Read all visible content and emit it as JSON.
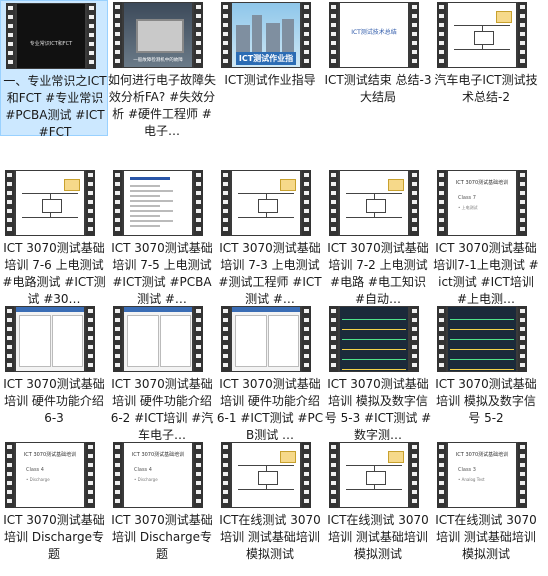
{
  "tiles": [
    {
      "caption": "一、专业常识之ICT和FCT #专业常识 #PCBA测试 #ICT #FCT",
      "thumb": "dark",
      "dark_title": "专业常识ICT和FCT",
      "selected": true
    },
    {
      "caption": "如何进行电子故障失效分析FA? #失效分析 #硬件工程师 #电子…",
      "thumb": "photo",
      "sub": "一般故障检测机中的故障"
    },
    {
      "caption": "ICT测试作业指导",
      "thumb": "city",
      "banner": "ICT测试作业指导"
    },
    {
      "caption": "ICT测试结束 总结-3 大结局",
      "thumb": "slide",
      "slide_title": "ICT测试技术总结"
    },
    {
      "caption": "汽车电子ICT测试技术总结-2",
      "thumb": "circuit"
    },
    {
      "caption": "ICT 3070测试基础培训 7-6 上电测试 #电路测试 #ICT测试 #30…",
      "thumb": "circuit"
    },
    {
      "caption": "ICT 3070测试基础培训 7-5 上电测试 #ICT测试 #PCBA测试 #…",
      "thumb": "doc"
    },
    {
      "caption": "ICT 3070测试基础培训 7-3 上电测试 #测试工程师 #ICT测试 #…",
      "thumb": "circuit"
    },
    {
      "caption": "ICT 3070测试基础培训 7-2 上电测试 #电路 #电工知识 #自动…",
      "thumb": "circuit"
    },
    {
      "caption": "ICT 3070测试基础培训7-1上电测试 #ict测试 #ICT培训 #上电测…",
      "thumb": "class",
      "t1": "ICT 3070测试基础培训",
      "t2": "Class 7",
      "t3": "• 上电测试"
    },
    {
      "caption": "ICT 3070测试基础培训 硬件功能介绍 6-3",
      "thumb": "win"
    },
    {
      "caption": "ICT 3070测试基础培训 硬件功能介绍 6-2 #ICT培训 #汽车电子…",
      "thumb": "win"
    },
    {
      "caption": "ICT 3070测试基础培训 硬件功能介绍 6-1 #ICT测试 #PCB测试 …",
      "thumb": "win"
    },
    {
      "caption": "ICT 3070测试基础培训 模拟及数字信号 5-3 #ICT测试 #数字测…",
      "thumb": "scope"
    },
    {
      "caption": "ICT 3070测试基础培训 模拟及数字信号 5-2",
      "thumb": "scope"
    },
    {
      "caption": "ICT 3070测试基础培训 Discharge专题",
      "thumb": "class",
      "t1": "ICT 3070测试基础培训",
      "t2": "Class 4",
      "t3": "• Discharge"
    },
    {
      "caption": "ICT 3070测试基础培训 Discharge专题",
      "thumb": "class",
      "t1": "ICT 3070测试基础培训",
      "t2": "Class 4",
      "t3": "• Discharge"
    },
    {
      "caption": "ICT在线测试 3070培训 测试基础培训 模拟测试",
      "thumb": "circuit"
    },
    {
      "caption": "ICT在线测试 3070培训 测试基础培训 模拟测试",
      "thumb": "circuit"
    },
    {
      "caption": "ICT在线测试 3070培训 测试基础培训 模拟测试",
      "thumb": "class",
      "t1": "ICT 3070测试基础培训",
      "t2": "Class 3",
      "t3": "• Analog Test"
    }
  ]
}
